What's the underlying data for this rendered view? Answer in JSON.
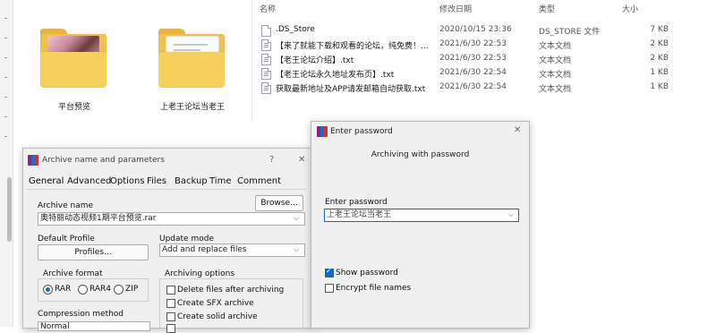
{
  "explorer": {
    "folders": [
      {
        "label": "平台预览",
        "thumb": "photo"
      },
      {
        "label": "上老王论坛当老王",
        "thumb": "document"
      }
    ],
    "columns": {
      "name": "名称",
      "modified": "修改日期",
      "type": "类型",
      "size": "大小"
    },
    "files": [
      {
        "name": ".DS_Store",
        "modified": "2020/10/15 23:36",
        "type": "DS_STORE 文件",
        "size": "7 KB"
      },
      {
        "name": "【来了就能下载和观看的论坛，纯免费！...",
        "modified": "2021/6/30 22:53",
        "type": "文本文档",
        "size": "2 KB"
      },
      {
        "name": "【老王论坛介绍】.txt",
        "modified": "2021/6/30 22:53",
        "type": "文本文档",
        "size": "2 KB"
      },
      {
        "name": "【老王论坛永久地址发布页】.txt",
        "modified": "2021/6/30 22:54",
        "type": "文本文档",
        "size": "1 KB"
      },
      {
        "name": "获取最新地址及APP请发邮箱自动获取.txt",
        "modified": "2021/6/30 22:54",
        "type": "文本文档",
        "size": "1 KB"
      }
    ]
  },
  "archive_dialog": {
    "title": "Archive name and parameters",
    "help": "?",
    "close": "✕",
    "tabs": [
      "General",
      "Advanced",
      "Options",
      "Files",
      "Backup",
      "Time",
      "Comment"
    ],
    "archive_name_label": "Archive name",
    "browse_label": "Browse...",
    "archive_name_value": "奥特丽动态视频1期平台预览.rar",
    "default_profile_label": "Default Profile",
    "profiles_label": "Profiles...",
    "update_mode_label": "Update mode",
    "update_mode_value": "Add and replace files",
    "archive_format_label": "Archive format",
    "formats": [
      {
        "label": "RAR",
        "selected": true
      },
      {
        "label": "RAR4",
        "selected": false
      },
      {
        "label": "ZIP",
        "selected": false
      }
    ],
    "archiving_options_label": "Archiving options",
    "options": [
      {
        "label": "Delete files after archiving",
        "checked": false
      },
      {
        "label": "Create SFX archive",
        "checked": false
      },
      {
        "label": "Create solid archive",
        "checked": false
      }
    ],
    "compression_method_label": "Compression method",
    "compression_value": "Normal"
  },
  "password_dialog": {
    "title": "Enter password",
    "close": "✕",
    "heading": "Archiving with password",
    "enter_password_label": "Enter password",
    "password_value": "上老王论坛当老王",
    "show_password_label": "Show password",
    "show_password_checked": true,
    "encrypt_names_label": "Encrypt file names",
    "encrypt_names_checked": false
  },
  "colors": {
    "accent": "#1a66c7",
    "folder": "#f0c24b"
  }
}
